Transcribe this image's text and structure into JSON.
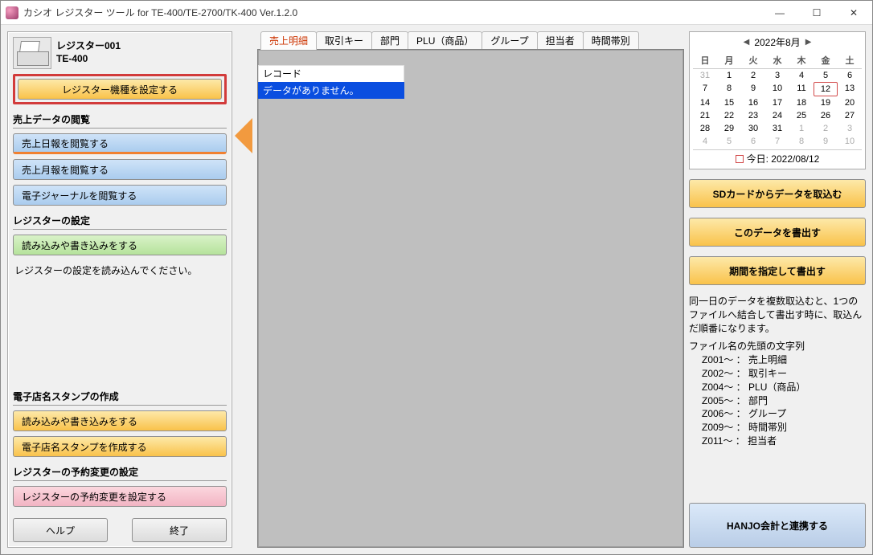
{
  "window": {
    "title": "カシオ レジスター ツール for TE-400/TE-2700/TK-400 Ver.1.2.0",
    "min": "—",
    "max": "☐",
    "close": "✕"
  },
  "register": {
    "name": "レジスター001",
    "model": "TE-400"
  },
  "sidebar": {
    "setModel": "レジスター機種を設定する",
    "sections": {
      "salesViewHead": "売上データの閲覧",
      "salesDaily": "売上日報を閲覧する",
      "salesMonthly": "売上月報を閲覧する",
      "ejournal": "電子ジャーナルを閲覧する",
      "settingsHead": "レジスターの設定",
      "readWrite": "読み込みや書き込みをする",
      "hint": "レジスターの設定を読み込んでください。",
      "stampHead": "電子店名スタンプの作成",
      "stampReadWrite": "読み込みや書き込みをする",
      "stampCreate": "電子店名スタンプを作成する",
      "reserveHead": "レジスターの予約変更の設定",
      "reserveSet": "レジスターの予約変更を設定する"
    },
    "help": "ヘルプ",
    "exit": "終了"
  },
  "tabs": [
    "売上明細",
    "取引キー",
    "部門",
    "PLU（商品）",
    "グループ",
    "担当者",
    "時間帯別"
  ],
  "viewer": {
    "recordHead": "レコード",
    "recordMsg": "データがありません。"
  },
  "calendar": {
    "navPrev": "◀",
    "navNext": "▶",
    "title": "2022年8月",
    "dow": [
      "日",
      "月",
      "火",
      "水",
      "木",
      "金",
      "土"
    ],
    "days": [
      {
        "n": 31,
        "o": true
      },
      {
        "n": 1
      },
      {
        "n": 2
      },
      {
        "n": 3
      },
      {
        "n": 4
      },
      {
        "n": 5
      },
      {
        "n": 6
      },
      {
        "n": 7
      },
      {
        "n": 8
      },
      {
        "n": 9
      },
      {
        "n": 10
      },
      {
        "n": 11
      },
      {
        "n": 12,
        "t": true
      },
      {
        "n": 13
      },
      {
        "n": 14
      },
      {
        "n": 15
      },
      {
        "n": 16
      },
      {
        "n": 17
      },
      {
        "n": 18
      },
      {
        "n": 19
      },
      {
        "n": 20
      },
      {
        "n": 21
      },
      {
        "n": 22
      },
      {
        "n": 23
      },
      {
        "n": 24
      },
      {
        "n": 25
      },
      {
        "n": 26
      },
      {
        "n": 27
      },
      {
        "n": 28
      },
      {
        "n": 29
      },
      {
        "n": 30
      },
      {
        "n": 31
      },
      {
        "n": 1,
        "o": true
      },
      {
        "n": 2,
        "o": true
      },
      {
        "n": 3,
        "o": true
      },
      {
        "n": 4,
        "o": true
      },
      {
        "n": 5,
        "o": true
      },
      {
        "n": 6,
        "o": true
      },
      {
        "n": 7,
        "o": true
      },
      {
        "n": 8,
        "o": true
      },
      {
        "n": 9,
        "o": true
      },
      {
        "n": 10,
        "o": true
      }
    ],
    "todayLabel": "今日: 2022/08/12"
  },
  "right": {
    "importSD": "SDカードからデータを取込む",
    "export": "このデータを書出す",
    "exportRange": "期間を指定して書出す",
    "note": "同一日のデータを複数取込むと、1つのファイルへ結合して書出す時に、取込んだ順番になります。",
    "fileHead": "ファイル名の先頭の文字列",
    "files": [
      "Z001～ ： 売上明細",
      "Z002～ ： 取引キー",
      "Z004～ ： PLU（商品）",
      "Z005～ ： 部門",
      "Z006～ ： グループ",
      "Z009～ ： 時間帯別",
      "Z011～ ： 担当者"
    ],
    "hanjo": "HANJO会計と連携する"
  }
}
